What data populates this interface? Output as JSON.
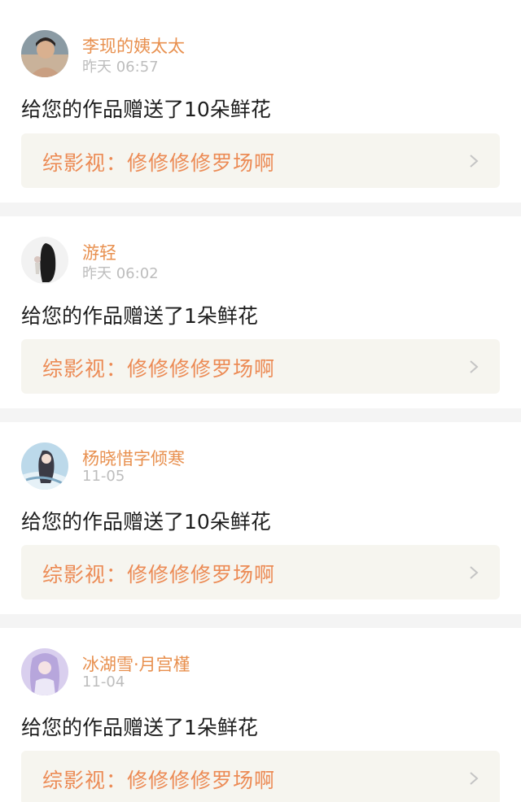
{
  "tab_indicator_color": "#e8779a",
  "notifications": [
    {
      "username": "李现的姨太太",
      "time": "昨天 06:57",
      "message": "给您的作品赠送了10朵鲜花",
      "work_title": "综影视：修修修修罗场啊",
      "avatar": "person-photo-avatar"
    },
    {
      "username": "游轻",
      "time": "昨天 06:02",
      "message": "给您的作品赠送了1朵鲜花",
      "work_title": "综影视：修修修修罗场啊",
      "avatar": "long-hair-figure-avatar"
    },
    {
      "username": "杨晓惜字倾寒",
      "time": "11-05",
      "message": "给您的作品赠送了10朵鲜花",
      "work_title": "综影视：修修修修罗场啊",
      "avatar": "anime-character-avatar"
    },
    {
      "username": "冰湖雪·月宫槿",
      "time": "11-04",
      "message": "给您的作品赠送了1朵鲜花",
      "work_title": "综影视：修修修修罗场啊",
      "avatar": "anime-purple-avatar"
    }
  ],
  "icons": {
    "chevron": "chevron-right-icon"
  },
  "colors": {
    "username": "#e8904f",
    "work_title": "#ec8b55",
    "work_link_bg": "#f6f5ef",
    "separator": "#f4f4f4"
  }
}
